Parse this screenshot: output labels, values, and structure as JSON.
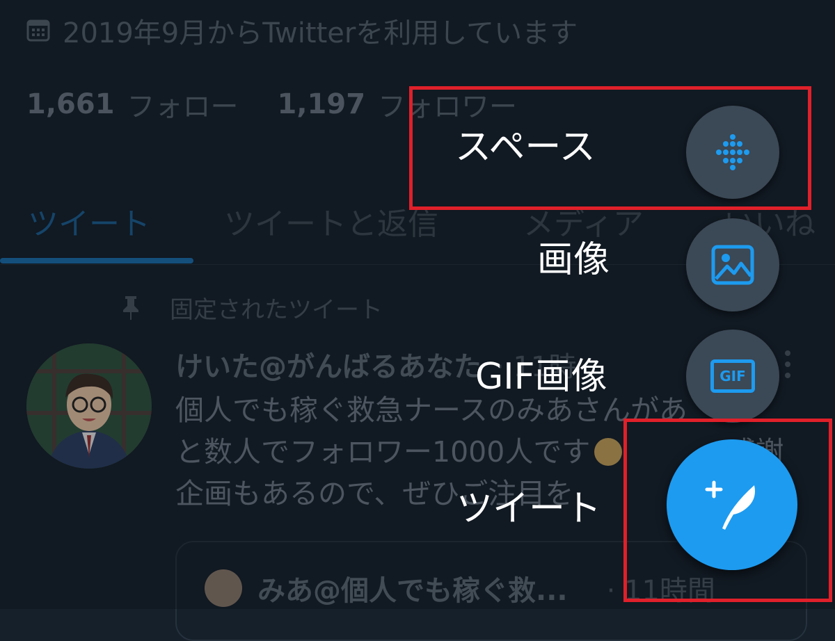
{
  "profile": {
    "joined": "2019年9月からTwitterを利用しています",
    "following_count": "1,661",
    "following_label": "フォロー",
    "followers_count": "1,197",
    "followers_label": "フォロワー"
  },
  "tabs": [
    {
      "label": "ツイート",
      "active": true
    },
    {
      "label": "ツイートと返信",
      "active": false
    },
    {
      "label": "メディア",
      "active": false
    },
    {
      "label": "いいね",
      "active": false
    }
  ],
  "pinned_label": "固定されたツイート",
  "tweet": {
    "name": "けいた@がんばるあなた",
    "time": "· 11時",
    "body_lines": [
      "個人でも稼ぐ救急ナースのみあさんがあ",
      "と数人でフォロワー1000人です",
      "企画もあるので、ぜひご注目を"
    ],
    "body_line2_suffix": "感謝"
  },
  "quote": {
    "name": "みあ@個人でも稼ぐ救...",
    "time": "· 11時間"
  },
  "fab_menu": {
    "space_label": "スペース",
    "image_label": "画像",
    "gif_label": "GIF画像",
    "gif_icon_text": "GIF",
    "tweet_label": "ツイート"
  },
  "colors": {
    "background": "#15202b",
    "accent": "#1d9bf0",
    "highlight_box": "#e0202a"
  }
}
